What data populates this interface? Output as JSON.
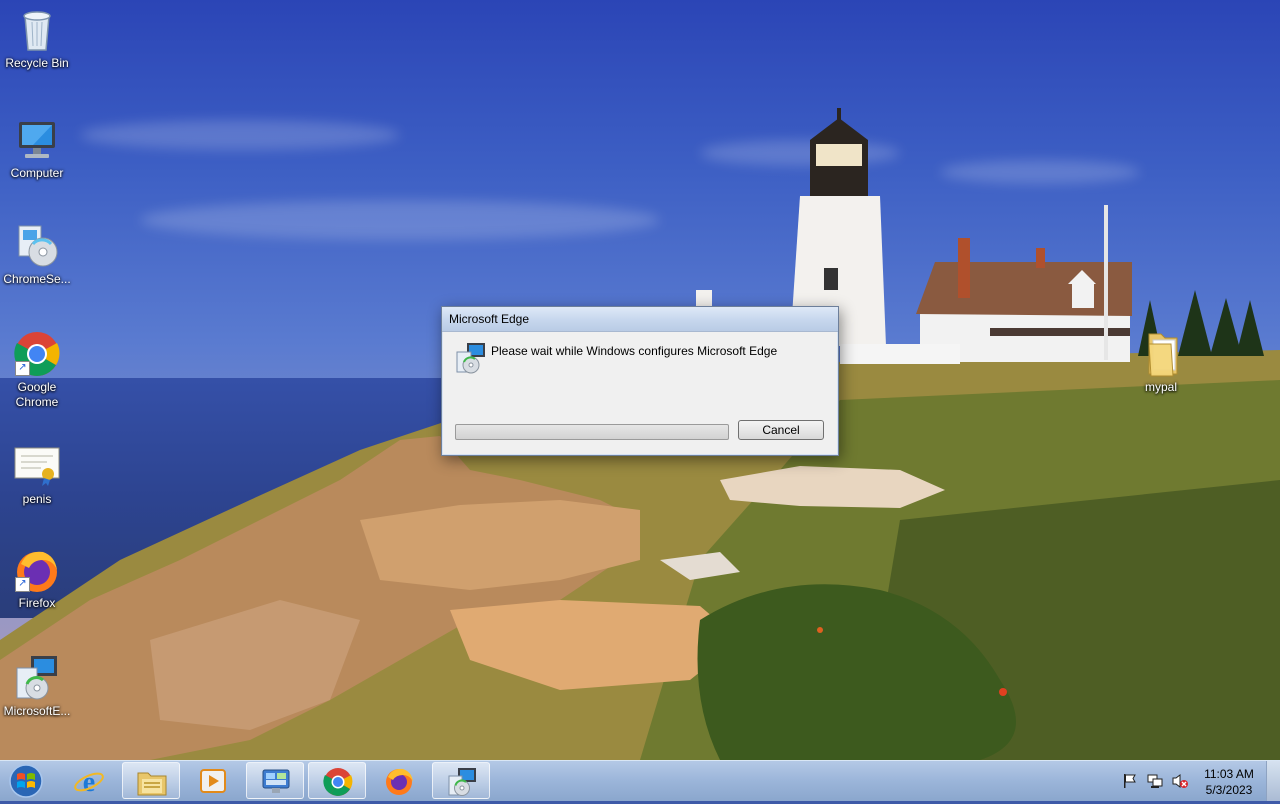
{
  "desktop": {
    "icons": [
      {
        "id": "recycle-bin",
        "label": "Recycle Bin"
      },
      {
        "id": "computer",
        "label": "Computer"
      },
      {
        "id": "chrome-setup",
        "label": "ChromeSe..."
      },
      {
        "id": "google-chrome",
        "label": "Google Chrome"
      },
      {
        "id": "penis",
        "label": "penis"
      },
      {
        "id": "firefox",
        "label": "Firefox"
      },
      {
        "id": "microsoft-edge",
        "label": "MicrosoftE..."
      },
      {
        "id": "mypal",
        "label": "mypal"
      }
    ]
  },
  "dialog": {
    "title": "Microsoft Edge",
    "message": "Please wait while Windows configures Microsoft Edge",
    "cancel_label": "Cancel",
    "progress_percent": 0,
    "icon": "installer-icon"
  },
  "taskbar": {
    "start_icon": "windows-logo-icon",
    "items": [
      {
        "name": "internet-explorer-icon"
      },
      {
        "name": "file-explorer-icon"
      },
      {
        "name": "media-player-icon"
      },
      {
        "name": "control-panel-icon"
      },
      {
        "name": "chrome-icon"
      },
      {
        "name": "firefox-icon"
      },
      {
        "name": "installer-icon"
      }
    ],
    "tray_icons": [
      "flag-icon",
      "network-icon",
      "volume-muted-icon"
    ],
    "clock": {
      "time": "11:03 AM",
      "date": "5/3/2023"
    }
  },
  "colors": {
    "accent": "#3e5aa8",
    "dialog_bg": "#f0f0f0",
    "taskbar": "#a8bedc"
  }
}
